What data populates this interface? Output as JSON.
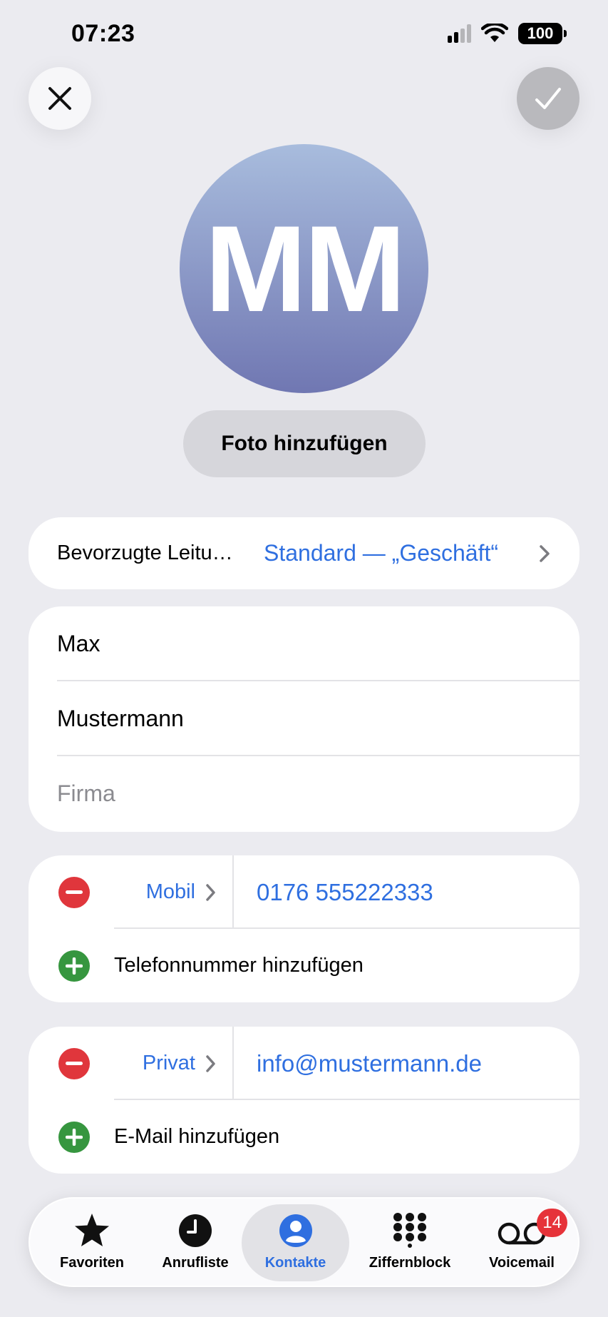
{
  "status_bar": {
    "time": "07:23",
    "battery": "100"
  },
  "avatar": {
    "initials": "MM"
  },
  "photo_button": "Foto hinzufügen",
  "line": {
    "label": "Bevorzugte Leitu…",
    "value": "Standard — „Geschäft“"
  },
  "name": {
    "first": "Max",
    "last": "Mustermann",
    "company_placeholder": "Firma"
  },
  "phone": {
    "type": "Mobil",
    "value": "0176 555222333",
    "add_label": "Telefonnummer hinzufügen"
  },
  "email": {
    "type": "Privat",
    "value": "info@mustermann.de",
    "add_label": "E-Mail hinzufügen"
  },
  "tabs": [
    {
      "label": "Favoriten",
      "icon": "star-icon"
    },
    {
      "label": "Anrufliste",
      "icon": "clock-icon"
    },
    {
      "label": "Kontakte",
      "icon": "person-icon",
      "active": true
    },
    {
      "label": "Ziffernblock",
      "icon": "keypad-icon"
    },
    {
      "label": "Voicemail",
      "icon": "voicemail-icon",
      "badge": "14"
    }
  ],
  "colors": {
    "accent": "#2f6fe0",
    "delete": "#e0363c",
    "add": "#36963f",
    "badge": "#e6333a"
  }
}
